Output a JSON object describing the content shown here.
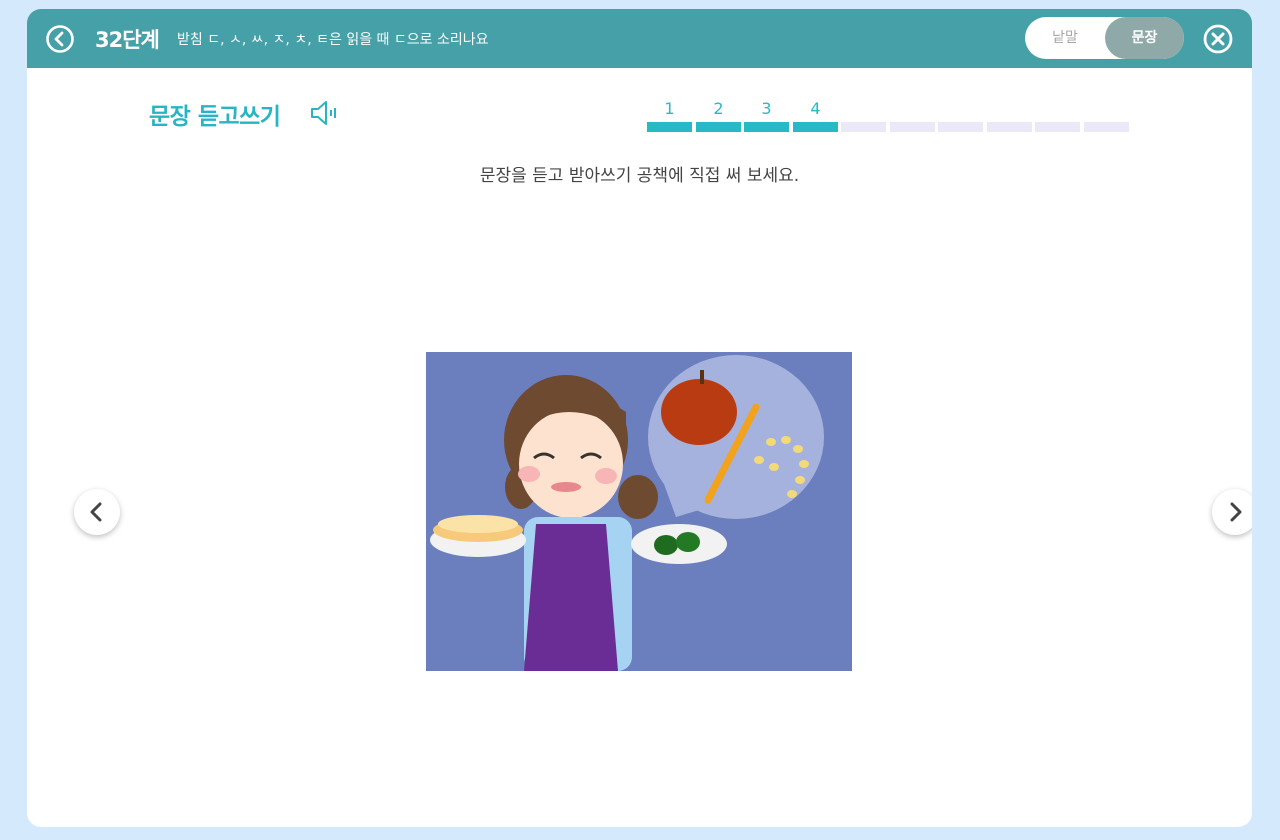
{
  "header": {
    "level": "32단계",
    "subtitle": "받침 ㄷ, ㅅ, ㅆ, ㅈ, ㅊ, ㅌ은 읽을 때 ㄷ으로 소리나요",
    "toggle": {
      "option1": "낱말",
      "option2": "문장",
      "selected": "문장"
    }
  },
  "main": {
    "title": "문장 듣고쓰기",
    "instruction": "문장을 듣고 받아쓰기 공책에 직접 써 보세요.",
    "progress": {
      "steps": [
        "1",
        "2",
        "3",
        "4"
      ],
      "total_segments": 10,
      "completed": 4
    }
  },
  "icons": {
    "back": "circle-chevron-left-icon",
    "close": "circle-x-icon",
    "speaker": "speaker-icon",
    "prev": "chevron-left-icon",
    "next": "chevron-right-icon"
  },
  "colors": {
    "page_bg": "#d4e9fb",
    "header_bg": "#45a0a8",
    "accent": "#27b9c6",
    "progress_empty": "#ebe8fa",
    "toggle_active": "#8fa9a9"
  }
}
